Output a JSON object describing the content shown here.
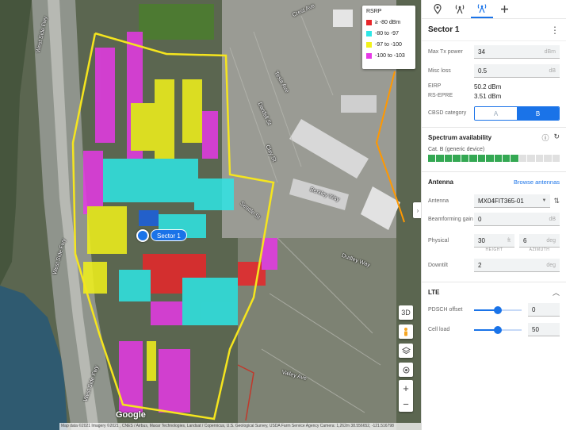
{
  "map": {
    "road_labels": [
      "West Side Fwy",
      "West Side Fwy",
      "West Side Fwy",
      "Crest Ave",
      "Tesla Ave",
      "Dudley Way",
      "Berkley Way",
      "Valley Ave",
      "Seattle St",
      "Dardell St",
      "Clay St"
    ],
    "legend": {
      "title": "RSRP",
      "items": [
        {
          "label": "≥ -80 dBm",
          "color": "#e8262a"
        },
        {
          "label": "-80 to -97",
          "color": "#2ee6e6"
        },
        {
          "label": "-97 to -100",
          "color": "#f2f21a"
        },
        {
          "label": "-100 to -103",
          "color": "#e639e6"
        }
      ]
    },
    "sector_label": "Sector 1",
    "controls": {
      "three_d": "3D",
      "zoom_in": "+",
      "zoom_out": "−"
    },
    "google": "Google",
    "attribution": "Map data ©2021 Imagery ©2021 , CNES / Airbus, Maxar Technologies, Landsat / Copernicus, U.S. Geological Survey, USDA Farm Service Agency   Camera: 1,262m   38.556652, -121.516798"
  },
  "panel": {
    "title": "Sector 1",
    "menu_glyph": "⋮",
    "fields": {
      "max_tx_power": {
        "label": "Max Tx power",
        "value": "34",
        "unit": "dBm"
      },
      "misc_loss": {
        "label": "Misc loss",
        "value": "0.5",
        "unit": "dB"
      },
      "eirp": {
        "label": "EIRP",
        "value": "50.2 dBm"
      },
      "rs_epre": {
        "label": "RS-EPRE",
        "value": "3.51 dBm"
      },
      "cbsd": {
        "label": "CBSD category",
        "options": [
          "A",
          "B"
        ],
        "selected": "B"
      }
    },
    "spectrum": {
      "title": "Spectrum availability",
      "category": "Cat. B (generic device)",
      "available_fraction": 0.69,
      "colors": {
        "available": "#34a853",
        "unavailable": "#e0e0e0"
      }
    },
    "antenna": {
      "title": "Antenna",
      "browse": "Browse antennas",
      "antenna": {
        "label": "Antenna",
        "value": "MX04FIT365-01"
      },
      "beamforming": {
        "label": "Beamforming gain",
        "value": "0",
        "unit": "dB"
      },
      "physical": {
        "label": "Physical",
        "height": "30",
        "height_unit": "ft",
        "height_caption": "HEIGHT",
        "azimuth": "6",
        "azimuth_unit": "deg",
        "azimuth_caption": "AZIMUTH"
      },
      "downtilt": {
        "label": "Downtilt",
        "value": "2",
        "unit": "deg"
      }
    },
    "lte": {
      "title": "LTE",
      "pdsch": {
        "label": "PDSCH offset",
        "value": "0",
        "slider_fraction": 0.5
      },
      "cell_load": {
        "label": "Cell load",
        "value": "50",
        "slider_fraction": 0.5
      }
    }
  }
}
